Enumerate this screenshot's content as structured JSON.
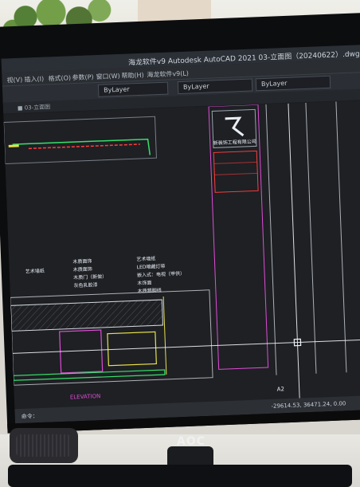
{
  "window": {
    "title": "海龙软件v9 Autodesk AutoCAD 2021    03-立面图（20240622）.dwg"
  },
  "menubar": {
    "items": [
      "视(V)",
      "插入(I)",
      "格式(O)",
      "参数(P)",
      "窗口(W)",
      "帮助(H)",
      "海龙软件v9(L)"
    ]
  },
  "toolbar": {
    "layer_label": "ByLayer",
    "lineweight_label": "ByLayer",
    "color_label": "ByLayer"
  },
  "drawing": {
    "labels": [
      "ELEVATION",
      "A2",
      "木质面饰",
      "艺术墙纸",
      "木质面饰",
      "木质门（新做）",
      "灰色乳胶漆",
      "艺术墙纸",
      "LED暗藏灯带",
      "嵌入式：电视（甲供）",
      "木饰面",
      "木质踢脚线"
    ],
    "logo_text": "新装饰工程有限公司"
  },
  "status": {
    "coords": "-29614.53, 36471.24, 0.00",
    "command_hint": "命令："
  },
  "brand": {
    "name": "AOC"
  },
  "colors": {
    "accent_magenta": "#e04dd6",
    "accent_yellow": "#e8e14a",
    "accent_green": "#37e06b",
    "accent_red": "#ff3d3d",
    "line_white": "#e9eef5",
    "bg_cad": "#1e2024"
  }
}
